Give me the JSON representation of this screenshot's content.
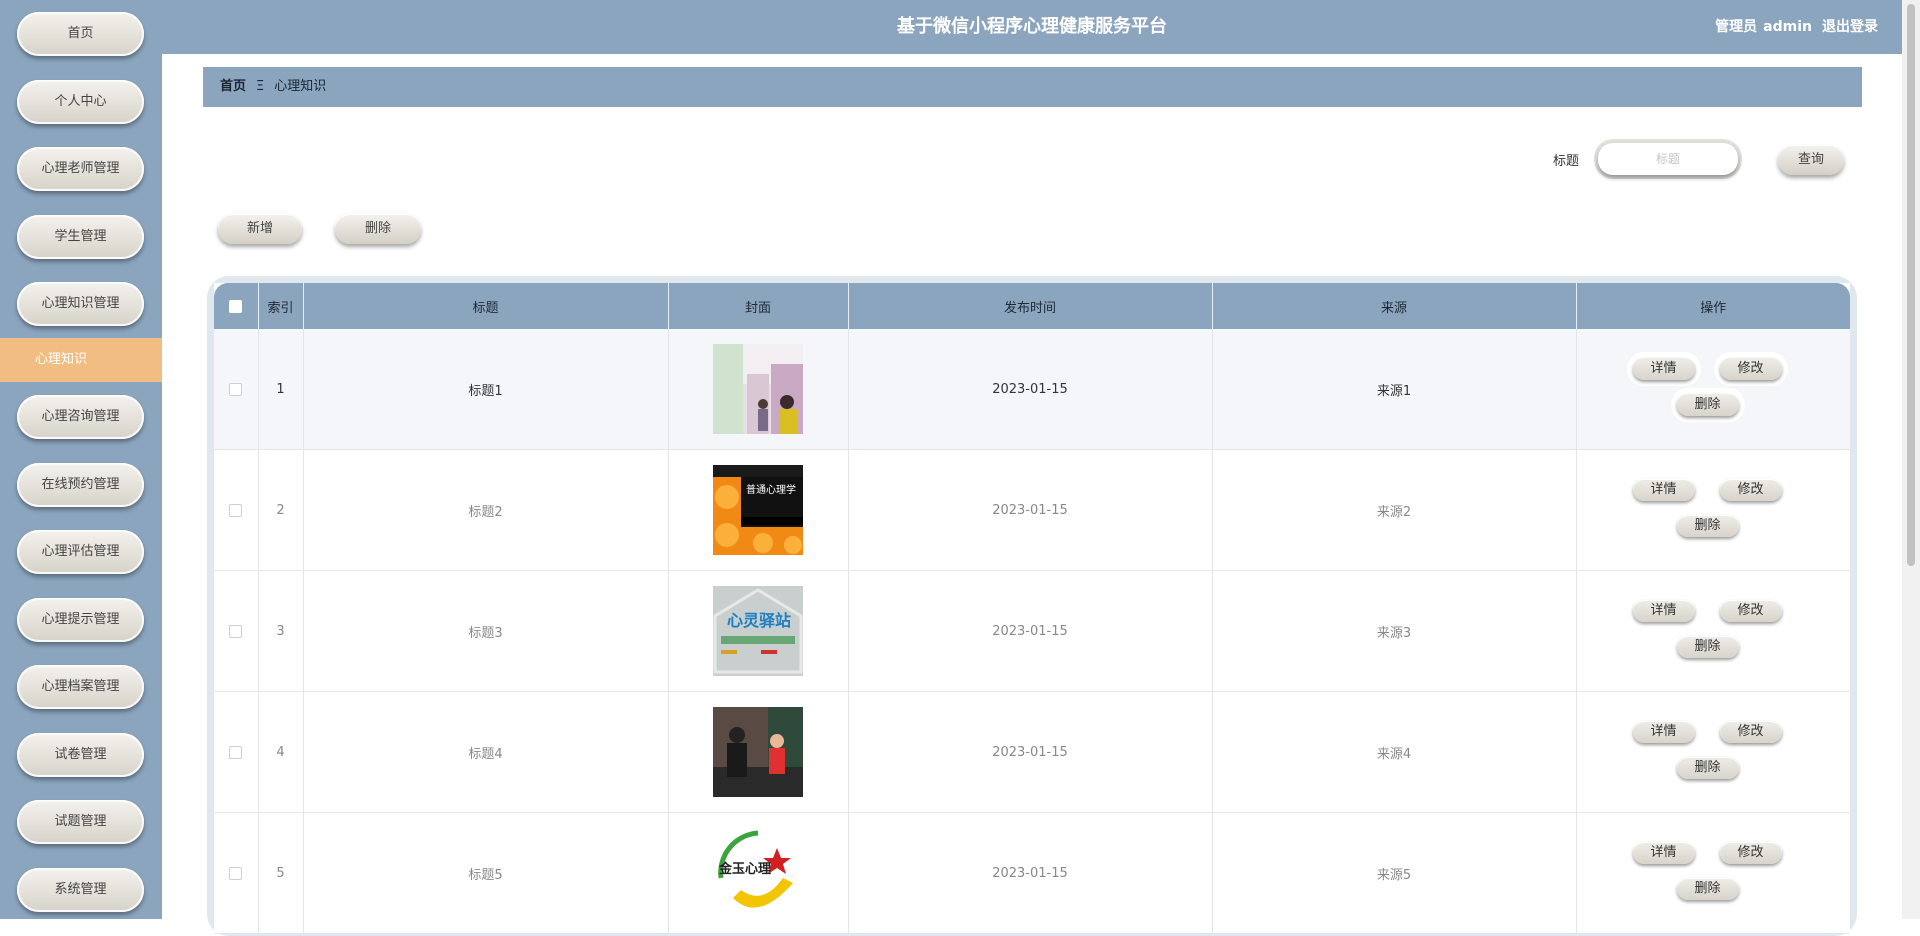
{
  "header": {
    "title": "基于微信小程序心理健康服务平台",
    "user_role": "管理员",
    "username": "admin",
    "logout_label": "退出登录"
  },
  "sidebar": {
    "items": [
      {
        "label": "首页"
      },
      {
        "label": "个人中心"
      },
      {
        "label": "心理老师管理"
      },
      {
        "label": "学生管理"
      },
      {
        "label": "心理知识管理"
      },
      {
        "label": "心理知识"
      },
      {
        "label": "心理咨询管理"
      },
      {
        "label": "在线预约管理"
      },
      {
        "label": "心理评估管理"
      },
      {
        "label": "心理提示管理"
      },
      {
        "label": "心理档案管理"
      },
      {
        "label": "试卷管理"
      },
      {
        "label": "试题管理"
      },
      {
        "label": "系统管理"
      }
    ]
  },
  "breadcrumb": {
    "home": "首页",
    "separator": "Ξ",
    "current": "心理知识"
  },
  "search": {
    "label": "标题",
    "placeholder": "标题",
    "button_label": "查询"
  },
  "toolbar": {
    "add_label": "新增",
    "delete_label": "删除"
  },
  "table": {
    "columns": [
      "索引",
      "标题",
      "封面",
      "发布时间",
      "来源",
      "操作"
    ],
    "rows": [
      {
        "index": "1",
        "title": "标题1",
        "date": "2023-01-15",
        "source": "来源1"
      },
      {
        "index": "2",
        "title": "标题2",
        "date": "2023-01-15",
        "source": "来源2"
      },
      {
        "index": "3",
        "title": "标题3",
        "date": "2023-01-15",
        "source": "来源3"
      },
      {
        "index": "4",
        "title": "标题4",
        "date": "2023-01-15",
        "source": "来源4"
      },
      {
        "index": "5",
        "title": "标题5",
        "date": "2023-01-15",
        "source": "来源5"
      }
    ],
    "actions": {
      "detail": "详情",
      "edit": "修改",
      "delete": "删除"
    },
    "cover_texts": {
      "book_title": "普通心理学",
      "sign_text": "心灵驿站",
      "logo_text": "金玉心理"
    }
  },
  "colors": {
    "theme_blue": "#8ba5bf",
    "active_orange": "#f2bd82"
  }
}
